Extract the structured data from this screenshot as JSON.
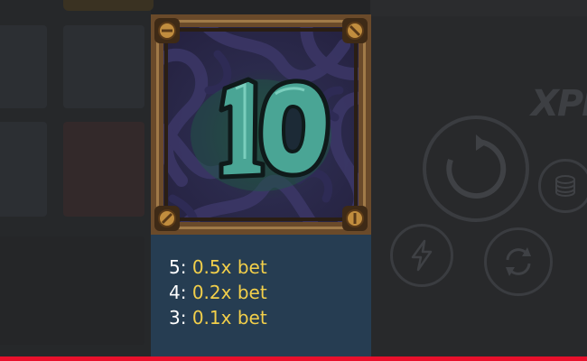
{
  "popup": {
    "symbol": {
      "name": "10",
      "icon": "number-10-symbol-icon"
    },
    "paytable": [
      {
        "count": "5:",
        "value": "0.5x bet"
      },
      {
        "count": "4:",
        "value": "0.2x bet"
      },
      {
        "count": "3:",
        "value": "0.1x bet"
      }
    ]
  },
  "background": {
    "brand_text": "XPRES"
  },
  "colors": {
    "paytable_value": "#f2cf4a",
    "paytable_count": "#ffffff",
    "popup_bg": "#263d52",
    "accent_bar": "#e8102b"
  }
}
